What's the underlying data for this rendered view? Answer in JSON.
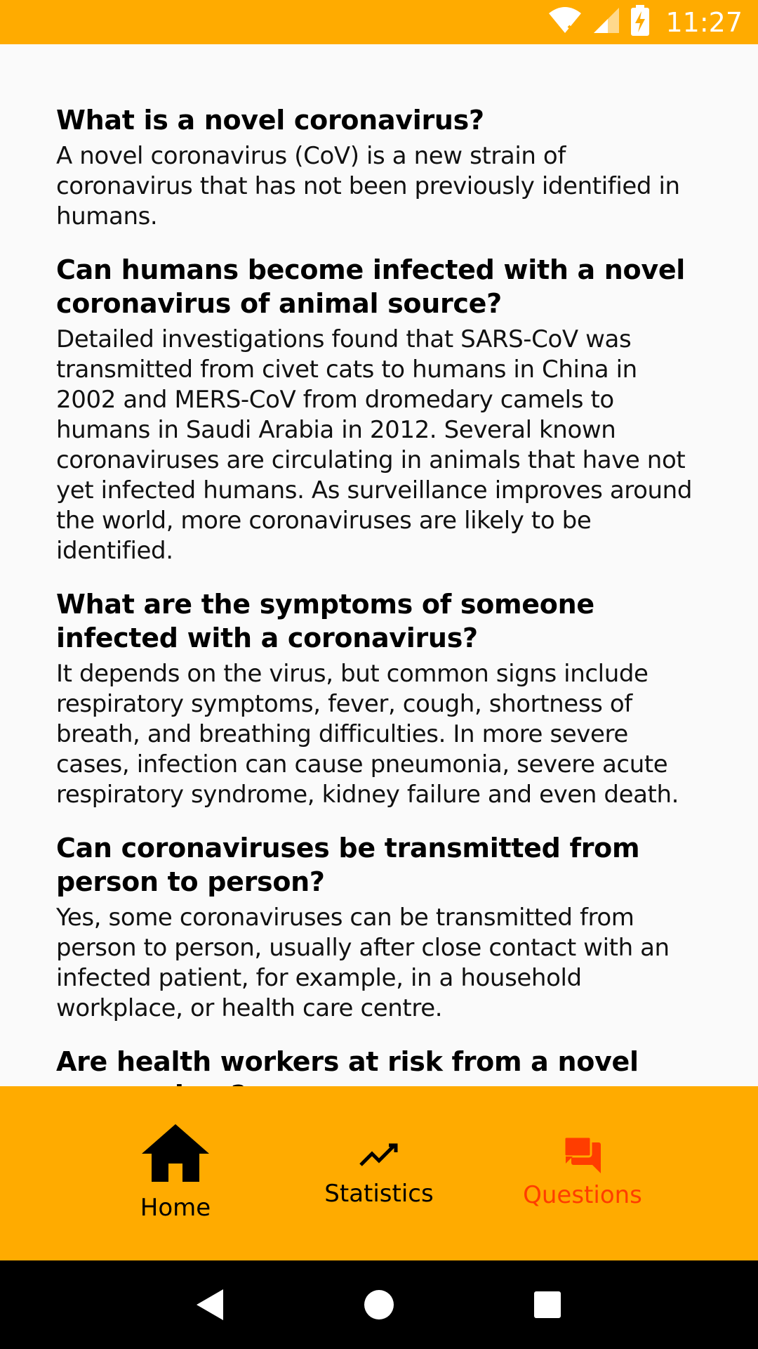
{
  "status_bar": {
    "time": "11:27",
    "icons": [
      "wifi-icon",
      "signal-icon",
      "battery-charging-icon"
    ]
  },
  "faq": [
    {
      "question": "What is a novel coronavirus?",
      "answer": "A novel coronavirus (CoV) is a new strain of coronavirus that has not been previously identified in humans."
    },
    {
      "question": "Can humans become infected with a novel coronavirus of animal source?",
      "answer": "Detailed investigations found that SARS-CoV was transmitted from civet cats to humans in China in 2002 and MERS-CoV from dromedary camels to humans in Saudi Arabia in 2012. Several known coronaviruses are circulating in animals that have not yet infected humans. As surveillance improves around the world, more coronaviruses are likely to be identified."
    },
    {
      "question": "What are the symptoms of someone infected with a coronavirus?",
      "answer": "It depends on the virus, but common signs include respiratory symptoms, fever, cough, shortness of breath, and breathing difficulties. In more severe cases, infection can cause pneumonia, severe acute respiratory syndrome, kidney failure and even death."
    },
    {
      "question": "Can coronaviruses be transmitted from person to person?",
      "answer": "Yes, some coronaviruses can be transmitted from person to person, usually after close contact with an infected patient, for example, in a household workplace, or health care centre."
    },
    {
      "question": "Are health workers at risk from a novel coronavirus?",
      "answer": ""
    }
  ],
  "bottom_nav": {
    "home": {
      "label": "Home",
      "icon": "home-icon"
    },
    "statistics": {
      "label": "Statistics",
      "icon": "trending-line-icon"
    },
    "questions": {
      "label": "Questions",
      "icon": "chat-bubbles-icon",
      "active": true
    }
  },
  "colors": {
    "accent": "#ffab00",
    "active": "#ff3d00",
    "background": "#fafafa"
  }
}
